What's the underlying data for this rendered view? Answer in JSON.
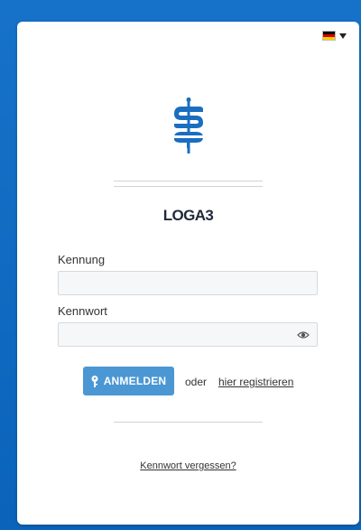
{
  "language": {
    "flag_colors": [
      "#000000",
      "#dd0000",
      "#ffce00"
    ],
    "icon": "german-flag-icon"
  },
  "product": {
    "name": "LOGA3"
  },
  "login": {
    "username_label": "Kennung",
    "username_value": "",
    "password_label": "Kennwort",
    "password_value": "",
    "submit_label": "ANMELDEN",
    "or_text": "oder",
    "register_link": "hier registrieren",
    "forgot_link": "Kennwort vergessen?"
  },
  "colors": {
    "page_background": "#0e6bc4",
    "logo_blue": "#1a6ec0",
    "button": "#4a97d4"
  }
}
